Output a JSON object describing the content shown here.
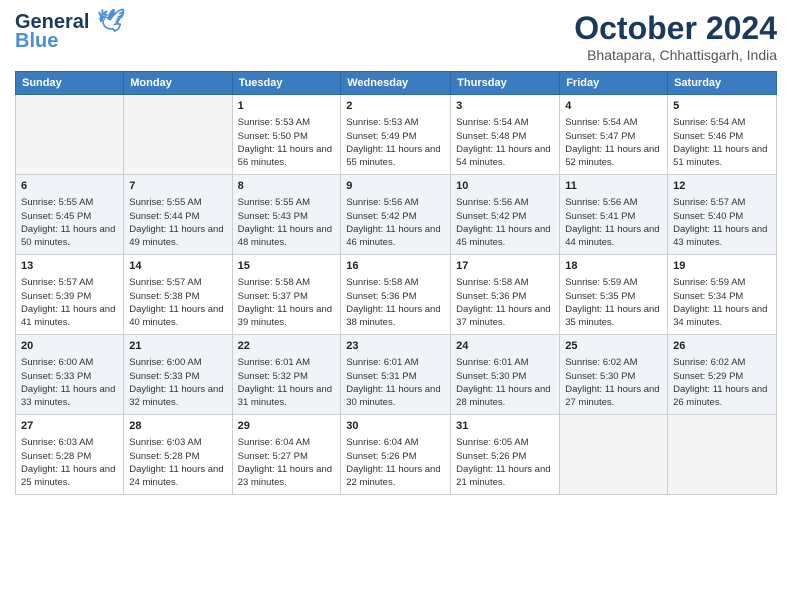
{
  "logo": {
    "line1": "General",
    "line2": "Blue"
  },
  "title": "October 2024",
  "location": "Bhatapara, Chhattisgarh, India",
  "weekdays": [
    "Sunday",
    "Monday",
    "Tuesday",
    "Wednesday",
    "Thursday",
    "Friday",
    "Saturday"
  ],
  "weeks": [
    [
      {
        "day": "",
        "sunrise": "",
        "sunset": "",
        "daylight": ""
      },
      {
        "day": "",
        "sunrise": "",
        "sunset": "",
        "daylight": ""
      },
      {
        "day": "1",
        "sunrise": "Sunrise: 5:53 AM",
        "sunset": "Sunset: 5:50 PM",
        "daylight": "Daylight: 11 hours and 56 minutes."
      },
      {
        "day": "2",
        "sunrise": "Sunrise: 5:53 AM",
        "sunset": "Sunset: 5:49 PM",
        "daylight": "Daylight: 11 hours and 55 minutes."
      },
      {
        "day": "3",
        "sunrise": "Sunrise: 5:54 AM",
        "sunset": "Sunset: 5:48 PM",
        "daylight": "Daylight: 11 hours and 54 minutes."
      },
      {
        "day": "4",
        "sunrise": "Sunrise: 5:54 AM",
        "sunset": "Sunset: 5:47 PM",
        "daylight": "Daylight: 11 hours and 52 minutes."
      },
      {
        "day": "5",
        "sunrise": "Sunrise: 5:54 AM",
        "sunset": "Sunset: 5:46 PM",
        "daylight": "Daylight: 11 hours and 51 minutes."
      }
    ],
    [
      {
        "day": "6",
        "sunrise": "Sunrise: 5:55 AM",
        "sunset": "Sunset: 5:45 PM",
        "daylight": "Daylight: 11 hours and 50 minutes."
      },
      {
        "day": "7",
        "sunrise": "Sunrise: 5:55 AM",
        "sunset": "Sunset: 5:44 PM",
        "daylight": "Daylight: 11 hours and 49 minutes."
      },
      {
        "day": "8",
        "sunrise": "Sunrise: 5:55 AM",
        "sunset": "Sunset: 5:43 PM",
        "daylight": "Daylight: 11 hours and 48 minutes."
      },
      {
        "day": "9",
        "sunrise": "Sunrise: 5:56 AM",
        "sunset": "Sunset: 5:42 PM",
        "daylight": "Daylight: 11 hours and 46 minutes."
      },
      {
        "day": "10",
        "sunrise": "Sunrise: 5:56 AM",
        "sunset": "Sunset: 5:42 PM",
        "daylight": "Daylight: 11 hours and 45 minutes."
      },
      {
        "day": "11",
        "sunrise": "Sunrise: 5:56 AM",
        "sunset": "Sunset: 5:41 PM",
        "daylight": "Daylight: 11 hours and 44 minutes."
      },
      {
        "day": "12",
        "sunrise": "Sunrise: 5:57 AM",
        "sunset": "Sunset: 5:40 PM",
        "daylight": "Daylight: 11 hours and 43 minutes."
      }
    ],
    [
      {
        "day": "13",
        "sunrise": "Sunrise: 5:57 AM",
        "sunset": "Sunset: 5:39 PM",
        "daylight": "Daylight: 11 hours and 41 minutes."
      },
      {
        "day": "14",
        "sunrise": "Sunrise: 5:57 AM",
        "sunset": "Sunset: 5:38 PM",
        "daylight": "Daylight: 11 hours and 40 minutes."
      },
      {
        "day": "15",
        "sunrise": "Sunrise: 5:58 AM",
        "sunset": "Sunset: 5:37 PM",
        "daylight": "Daylight: 11 hours and 39 minutes."
      },
      {
        "day": "16",
        "sunrise": "Sunrise: 5:58 AM",
        "sunset": "Sunset: 5:36 PM",
        "daylight": "Daylight: 11 hours and 38 minutes."
      },
      {
        "day": "17",
        "sunrise": "Sunrise: 5:58 AM",
        "sunset": "Sunset: 5:36 PM",
        "daylight": "Daylight: 11 hours and 37 minutes."
      },
      {
        "day": "18",
        "sunrise": "Sunrise: 5:59 AM",
        "sunset": "Sunset: 5:35 PM",
        "daylight": "Daylight: 11 hours and 35 minutes."
      },
      {
        "day": "19",
        "sunrise": "Sunrise: 5:59 AM",
        "sunset": "Sunset: 5:34 PM",
        "daylight": "Daylight: 11 hours and 34 minutes."
      }
    ],
    [
      {
        "day": "20",
        "sunrise": "Sunrise: 6:00 AM",
        "sunset": "Sunset: 5:33 PM",
        "daylight": "Daylight: 11 hours and 33 minutes."
      },
      {
        "day": "21",
        "sunrise": "Sunrise: 6:00 AM",
        "sunset": "Sunset: 5:33 PM",
        "daylight": "Daylight: 11 hours and 32 minutes."
      },
      {
        "day": "22",
        "sunrise": "Sunrise: 6:01 AM",
        "sunset": "Sunset: 5:32 PM",
        "daylight": "Daylight: 11 hours and 31 minutes."
      },
      {
        "day": "23",
        "sunrise": "Sunrise: 6:01 AM",
        "sunset": "Sunset: 5:31 PM",
        "daylight": "Daylight: 11 hours and 30 minutes."
      },
      {
        "day": "24",
        "sunrise": "Sunrise: 6:01 AM",
        "sunset": "Sunset: 5:30 PM",
        "daylight": "Daylight: 11 hours and 28 minutes."
      },
      {
        "day": "25",
        "sunrise": "Sunrise: 6:02 AM",
        "sunset": "Sunset: 5:30 PM",
        "daylight": "Daylight: 11 hours and 27 minutes."
      },
      {
        "day": "26",
        "sunrise": "Sunrise: 6:02 AM",
        "sunset": "Sunset: 5:29 PM",
        "daylight": "Daylight: 11 hours and 26 minutes."
      }
    ],
    [
      {
        "day": "27",
        "sunrise": "Sunrise: 6:03 AM",
        "sunset": "Sunset: 5:28 PM",
        "daylight": "Daylight: 11 hours and 25 minutes."
      },
      {
        "day": "28",
        "sunrise": "Sunrise: 6:03 AM",
        "sunset": "Sunset: 5:28 PM",
        "daylight": "Daylight: 11 hours and 24 minutes."
      },
      {
        "day": "29",
        "sunrise": "Sunrise: 6:04 AM",
        "sunset": "Sunset: 5:27 PM",
        "daylight": "Daylight: 11 hours and 23 minutes."
      },
      {
        "day": "30",
        "sunrise": "Sunrise: 6:04 AM",
        "sunset": "Sunset: 5:26 PM",
        "daylight": "Daylight: 11 hours and 22 minutes."
      },
      {
        "day": "31",
        "sunrise": "Sunrise: 6:05 AM",
        "sunset": "Sunset: 5:26 PM",
        "daylight": "Daylight: 11 hours and 21 minutes."
      },
      {
        "day": "",
        "sunrise": "",
        "sunset": "",
        "daylight": ""
      },
      {
        "day": "",
        "sunrise": "",
        "sunset": "",
        "daylight": ""
      }
    ]
  ]
}
